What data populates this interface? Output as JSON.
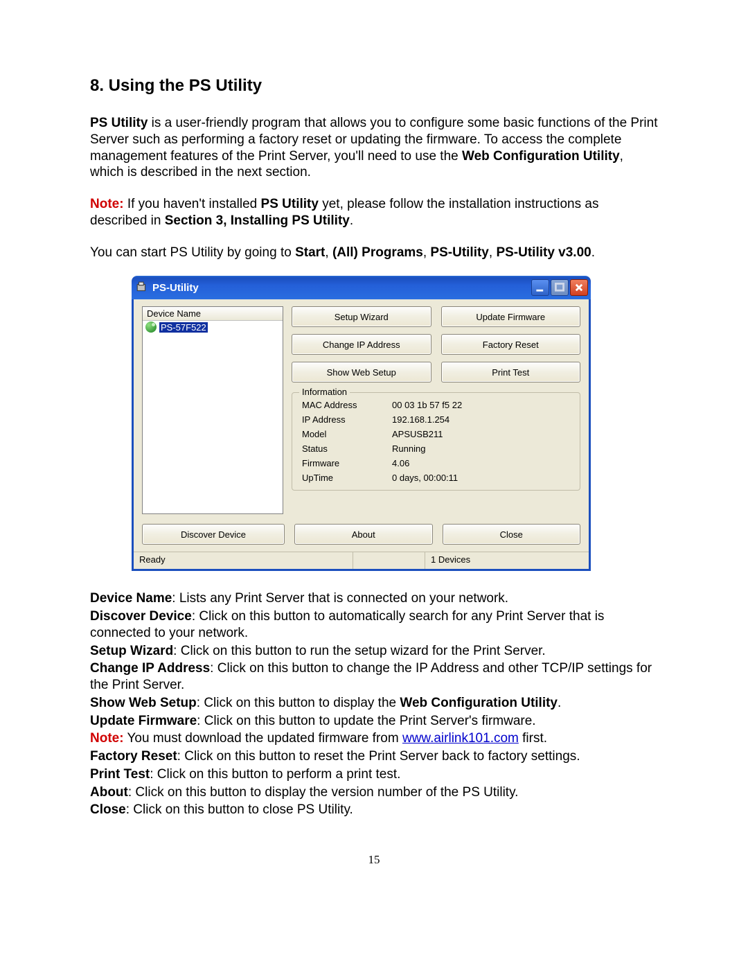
{
  "heading": "8. Using the PS Utility",
  "para1": {
    "a": "PS Utility",
    "b": " is a user-friendly program that allows you to configure some basic functions of the Print Server such as performing a factory reset or updating the firmware. To access the complete management features of the Print Server, you'll need to use the ",
    "c": "Web Configuration Utility",
    "d": ", which is described in the next section."
  },
  "para2": {
    "note": "Note:",
    "a": " If you haven't installed ",
    "b": "PS Utility",
    "c": " yet, please follow the installation instructions as described in ",
    "d": "Section 3, Installing PS Utility",
    "e": "."
  },
  "para3": {
    "a": "You can start PS Utility by going to ",
    "b": "Start",
    "c": "(All) Programs",
    "d": "PS-Utility",
    "e": "PS-Utility v3.00",
    "sep": ", ",
    "end": "."
  },
  "app": {
    "title": "PS-Utility",
    "deviceHeader": "Device Name",
    "deviceItem": "PS-57F522",
    "buttons": {
      "setup": "Setup Wizard",
      "update": "Update Firmware",
      "changeip": "Change IP Address",
      "factory": "Factory Reset",
      "showweb": "Show Web Setup",
      "printtest": "Print Test",
      "discover": "Discover Device",
      "about": "About",
      "close": "Close"
    },
    "info": {
      "legend": "Information",
      "mac_l": "MAC Address",
      "mac_v": "00 03 1b 57 f5 22",
      "ip_l": "IP Address",
      "ip_v": "192.168.1.254",
      "model_l": "Model",
      "model_v": "APSUSB211",
      "status_l": "Status",
      "status_v": "Running",
      "fw_l": "Firmware",
      "fw_v": "4.06",
      "up_l": "UpTime",
      "up_v": "0 days, 00:00:11"
    },
    "status": {
      "left": "Ready",
      "right": "1 Devices"
    }
  },
  "defs": {
    "device_name_t": "Device Name",
    "device_name_d": ": Lists any Print Server that is connected on your network.",
    "discover_t": "Discover Device",
    "discover_d": ": Click on this button to automatically search for any Print Server that is connected to your network.",
    "setup_t": "Setup Wizard",
    "setup_d": ": Click on this button to run the setup wizard for the Print Server.",
    "changeip_t": "Change IP Address",
    "changeip_d": ": Click on this button to change the IP Address and other TCP/IP settings for the Print Server.",
    "showweb_t": "Show Web Setup",
    "showweb_d1": ": Click on this button to display the ",
    "showweb_d2": "Web Configuration Utility",
    "showweb_d3": ".",
    "update_t": "Update Firmware",
    "update_d": ": Click on this button to update the Print Server's firmware.",
    "note_t": "Note:",
    "note_d1": " You must download the updated firmware from ",
    "note_link": "www.airlink101.com",
    "note_d2": " first.",
    "factory_t": "Factory Reset",
    "factory_d": ": Click on this button to reset the Print Server back to factory settings.",
    "print_t": "Print Test",
    "print_d": ": Click on this button to perform a print test.",
    "about_t": "About",
    "about_d": ": Click on this button to display the version number of the PS Utility.",
    "close_t": "Close",
    "close_d": ": Click on this button to close PS Utility."
  },
  "pagenum": "15"
}
